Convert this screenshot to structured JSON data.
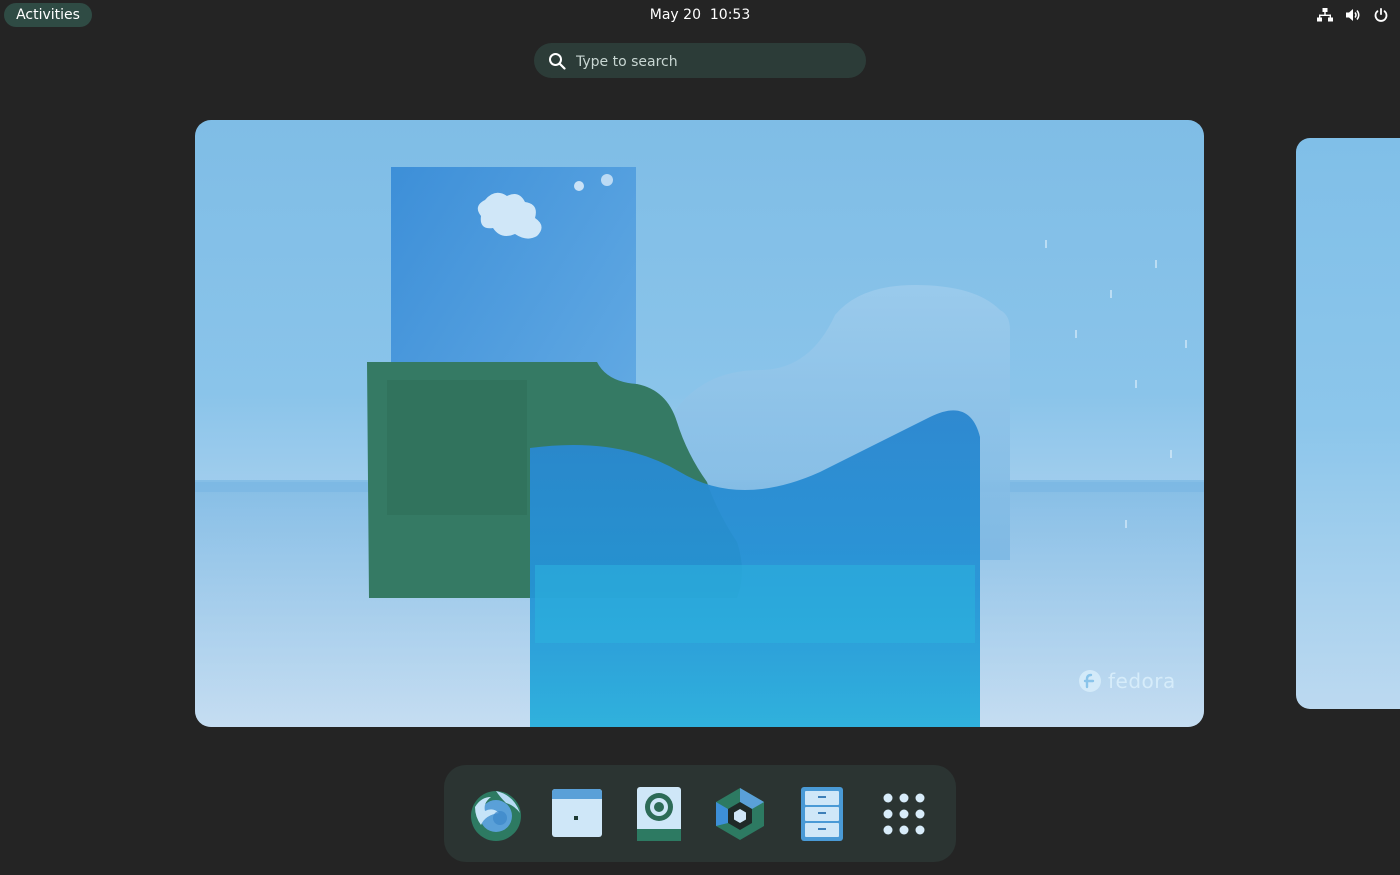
{
  "topbar": {
    "activities_label": "Activities",
    "clock": "May 20  10:53",
    "tray": [
      {
        "icon": "network-wired-icon"
      },
      {
        "icon": "volume-icon"
      },
      {
        "icon": "power-icon"
      }
    ]
  },
  "search": {
    "placeholder": "Type to search",
    "icon": "search-icon"
  },
  "workspace": {
    "wallpaper_logo_text": "fedora"
  },
  "dash": {
    "items": [
      {
        "name": "firefox",
        "icon": "firefox-icon"
      },
      {
        "name": "terminal",
        "icon": "terminal-icon"
      },
      {
        "name": "rhythmbox",
        "icon": "music-player-icon"
      },
      {
        "name": "fedora-media-writer",
        "icon": "media-writer-icon"
      },
      {
        "name": "files",
        "icon": "file-cabinet-icon"
      },
      {
        "name": "show-apps",
        "icon": "app-grid-icon"
      }
    ]
  },
  "colors": {
    "panel_bg": "#242424",
    "activities_bg": "#2f4b44",
    "search_bg": "#2c3c38",
    "dash_bg": "#2b3432",
    "accent_green": "#357a64",
    "wallpaper_blue": "#8ac4ea"
  }
}
